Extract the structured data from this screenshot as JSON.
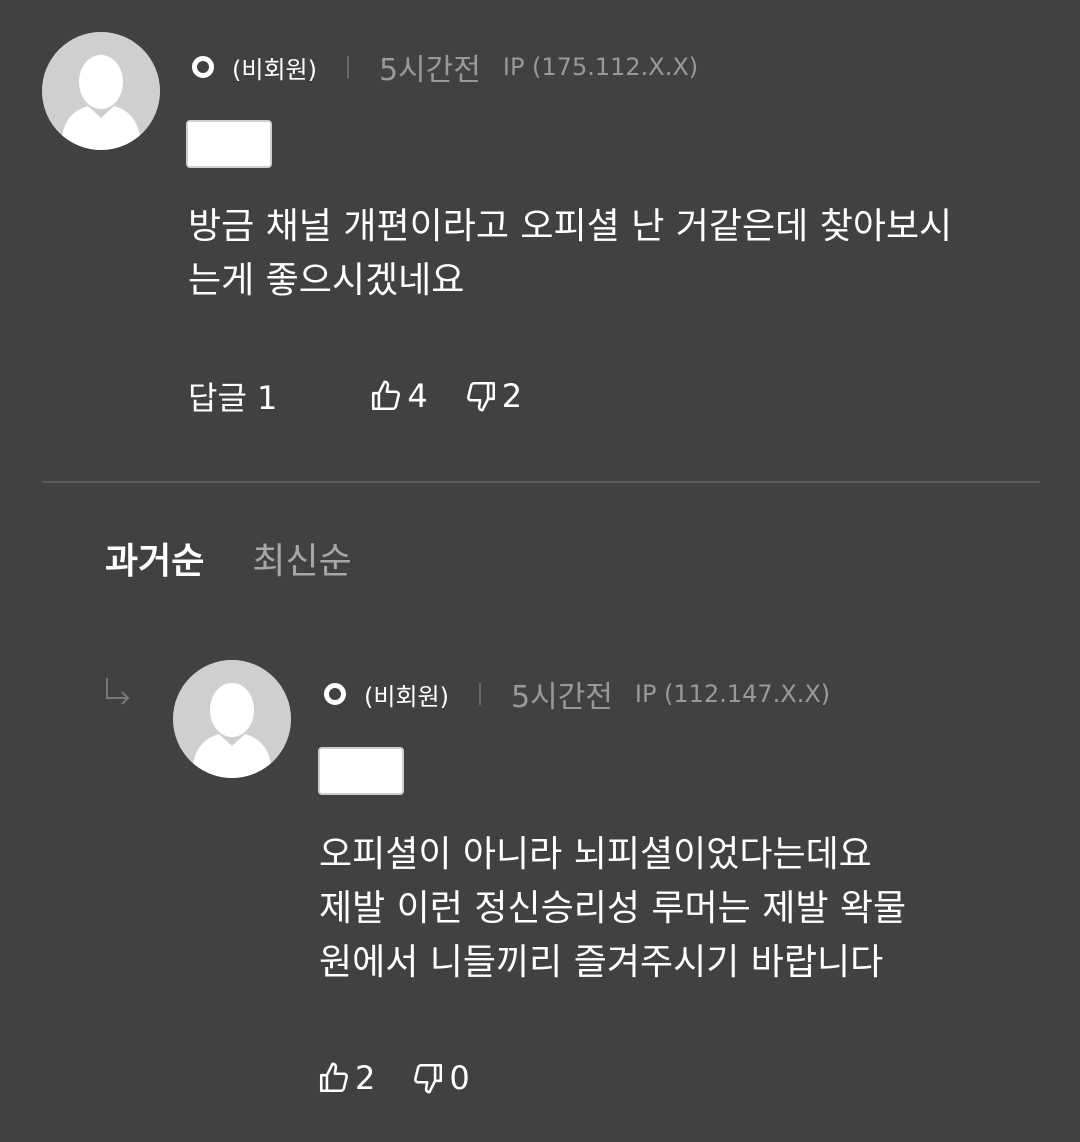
{
  "comment": {
    "nickname": "(비회원)",
    "time": "5시간전",
    "ip": "IP (175.112.X.X)",
    "body": "방금 채널 개편이라고 오피셜 난 거같은데 찾아보시\n는게 좋으시겠네요",
    "reply_label": "답글 1",
    "likes": "4",
    "dislikes": "2"
  },
  "sort_tabs": {
    "oldest": "과거순",
    "newest": "최신순"
  },
  "reply": {
    "nickname": "(비회원)",
    "time": "5시간전",
    "ip": "IP (112.147.X.X)",
    "body": "오피셜이 아니라 뇌피셜이었다는데요\n제발 이런 정신승리성 루머는 제발 왁물\n원에서 니들끼리 즐겨주시기 바랍니다",
    "likes": "2",
    "dislikes": "0"
  },
  "icons": {
    "avatar": "person-silhouette-icon",
    "member": "ring-icon",
    "like": "thumbs-up-icon",
    "dislike": "thumbs-down-icon",
    "reply": "reply-arrow-icon"
  },
  "colors": {
    "background": "#424140",
    "text": "#ffffff",
    "muted": "#9a9998",
    "avatar_bg": "#cfcfcf"
  }
}
